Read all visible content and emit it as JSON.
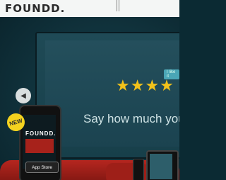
{
  "brand": {
    "logo_text": "FOUNDD."
  },
  "hero": {
    "tag_label": "I like it",
    "stars": "★★★★",
    "tagline": "Say how much you"
  },
  "carousel": {
    "prev_arrow": "◀"
  },
  "promo": {
    "badge": "NEW",
    "phone_logo": "FOUNDD.",
    "store_button": "App Store"
  },
  "colors": {
    "background": "#11343e",
    "star_color": "#f2c21a",
    "sofa_red": "#b5261f",
    "badge_yellow": "#f4d21f"
  },
  "icons": [
    "chevron-left-icon",
    "star-icon"
  ]
}
